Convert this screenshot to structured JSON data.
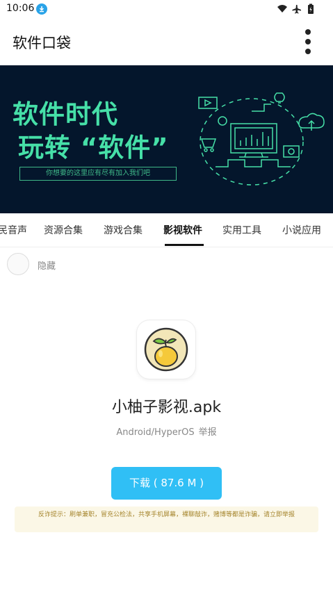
{
  "status_bar": {
    "time": "10:06"
  },
  "app_bar": {
    "title": "软件口袋"
  },
  "banner": {
    "line1": "软件时代",
    "line2": "玩转 “软件”",
    "slogan": "你想要的这里应有尽有加入我们吧"
  },
  "tabs": [
    {
      "label": "民音声"
    },
    {
      "label": "资源合集"
    },
    {
      "label": "游戏合集"
    },
    {
      "label": "影视软件",
      "active": true
    },
    {
      "label": "实用工具"
    },
    {
      "label": "小说应用"
    }
  ],
  "hide": {
    "label": "隐藏"
  },
  "app": {
    "name": "小柚子影视.apk",
    "platform": "Android/HyperOS",
    "report_label": "举报",
    "download_label": "下载 ( 87.6 M )"
  },
  "warning": "反诈提示：刷单兼职，冒充公检法，共享手机屏幕，裸聊敲诈，赌博等都是诈骗，请立即举报",
  "colors": {
    "accent": "#30bff5",
    "banner_bg": "#04162c",
    "banner_text": "#46e0a8"
  }
}
